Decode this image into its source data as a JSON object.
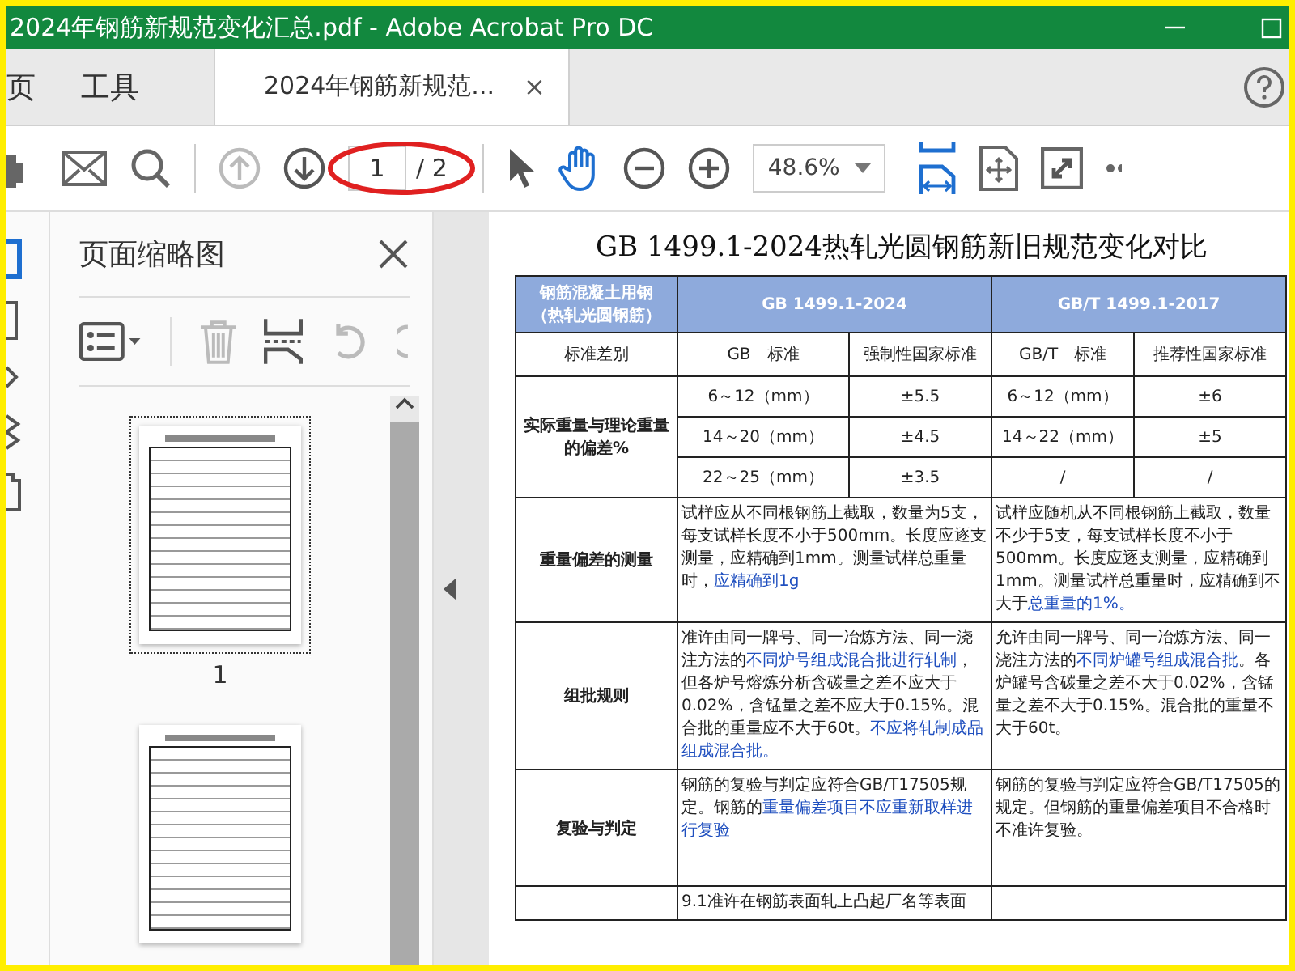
{
  "window": {
    "title": "2024年钢筋新规范变化汇总.pdf - Adobe Acrobat Pro DC"
  },
  "tabs": [
    {
      "label": "页",
      "selected": false
    },
    {
      "label": "工具",
      "selected": false
    },
    {
      "label": "2024年钢筋新规范...",
      "selected": true,
      "close_glyph": "×"
    }
  ],
  "toolbar": {
    "prev_page_disabled": true,
    "page_current": "1",
    "page_total": "/ 2",
    "zoom": "48.6%"
  },
  "thumbnails_panel": {
    "title": "页面缩略图",
    "pages": [
      {
        "label": "1",
        "selected": true
      },
      {
        "selected": false
      }
    ]
  },
  "document": {
    "title": "GB 1499.1-2024热轧光圆钢筋新旧规范变化对比",
    "header": {
      "label": "钢筋混凝土用钢（热轧光圆钢筋）",
      "new": "GB 1499.1-2024",
      "old": "GB/T 1499.1-2017"
    },
    "subheader": [
      "标准差别",
      "GB　标准",
      "强制性国家标准",
      "GB/T　标准",
      "推荐性国家标准"
    ],
    "deviation": {
      "label": "实际重量与理论重量的偏差%",
      "rows": [
        [
          "6～12（mm）",
          "±5.5",
          "6～12（mm）",
          "±6"
        ],
        [
          "14～20（mm）",
          "±4.5",
          "14～22（mm）",
          "±5"
        ],
        [
          "22～25（mm）",
          "±3.5",
          "/",
          "/"
        ]
      ]
    },
    "rows": [
      {
        "label": "重量偏差的测量",
        "new": [
          {
            "text": "试样应从不同根钢筋上截取，数量为5支，每支试样长度不小于500mm。长度应逐支测量，应精确到1mm。测量试样总重量时，",
            "changed": false
          },
          {
            "text": "应精确到1g",
            "changed": true
          }
        ],
        "old": [
          {
            "text": "试样应随机从不同根钢筋上截取，数量不少于5支，每支试样长度不小于500mm。长度应逐支测量，应精确到1mm。测量试样总重量时，应精确到不大于",
            "changed": false
          },
          {
            "text": "总重量的1%。",
            "changed": true
          }
        ]
      },
      {
        "label": "组批规则",
        "new": [
          {
            "text": "准许由同一牌号、同一冶炼方法、同一浇注方法的",
            "changed": false
          },
          {
            "text": "不同炉号组成混合批进行轧制",
            "changed": true
          },
          {
            "text": "，但各炉号熔炼分析含碳量之差不应大于0.02%，含锰量之差不应大于0.15%。混合批的重量应不大于60t。",
            "changed": false
          },
          {
            "text": "不应将轧制成品组成混合批。",
            "changed": true
          }
        ],
        "old": [
          {
            "text": "允许由同一牌号、同一冶炼方法、同一浇注方法的",
            "changed": false
          },
          {
            "text": "不同炉罐号组成混合批",
            "changed": true
          },
          {
            "text": "。各炉罐号含碳量之差不大于0.02%，含锰量之差不大于0.15%。混合批的重量不大于60t。",
            "changed": false
          }
        ]
      },
      {
        "label": "复验与判定",
        "new": [
          {
            "text": "钢筋的复验与判定应符合GB/T17505规定。钢筋的",
            "changed": false
          },
          {
            "text": "重量偏差项目不应重新取样进行复验",
            "changed": true
          }
        ],
        "old": [
          {
            "text": "钢筋的复验与判定应符合GB/T17505的规定。但钢筋的重量偏差项目不合格时不准许复验。",
            "changed": false
          }
        ]
      },
      {
        "new": [
          {
            "text": "9.1准许在钢筋表面轧上凸起厂名等表面",
            "changed": false
          }
        ]
      }
    ]
  }
}
